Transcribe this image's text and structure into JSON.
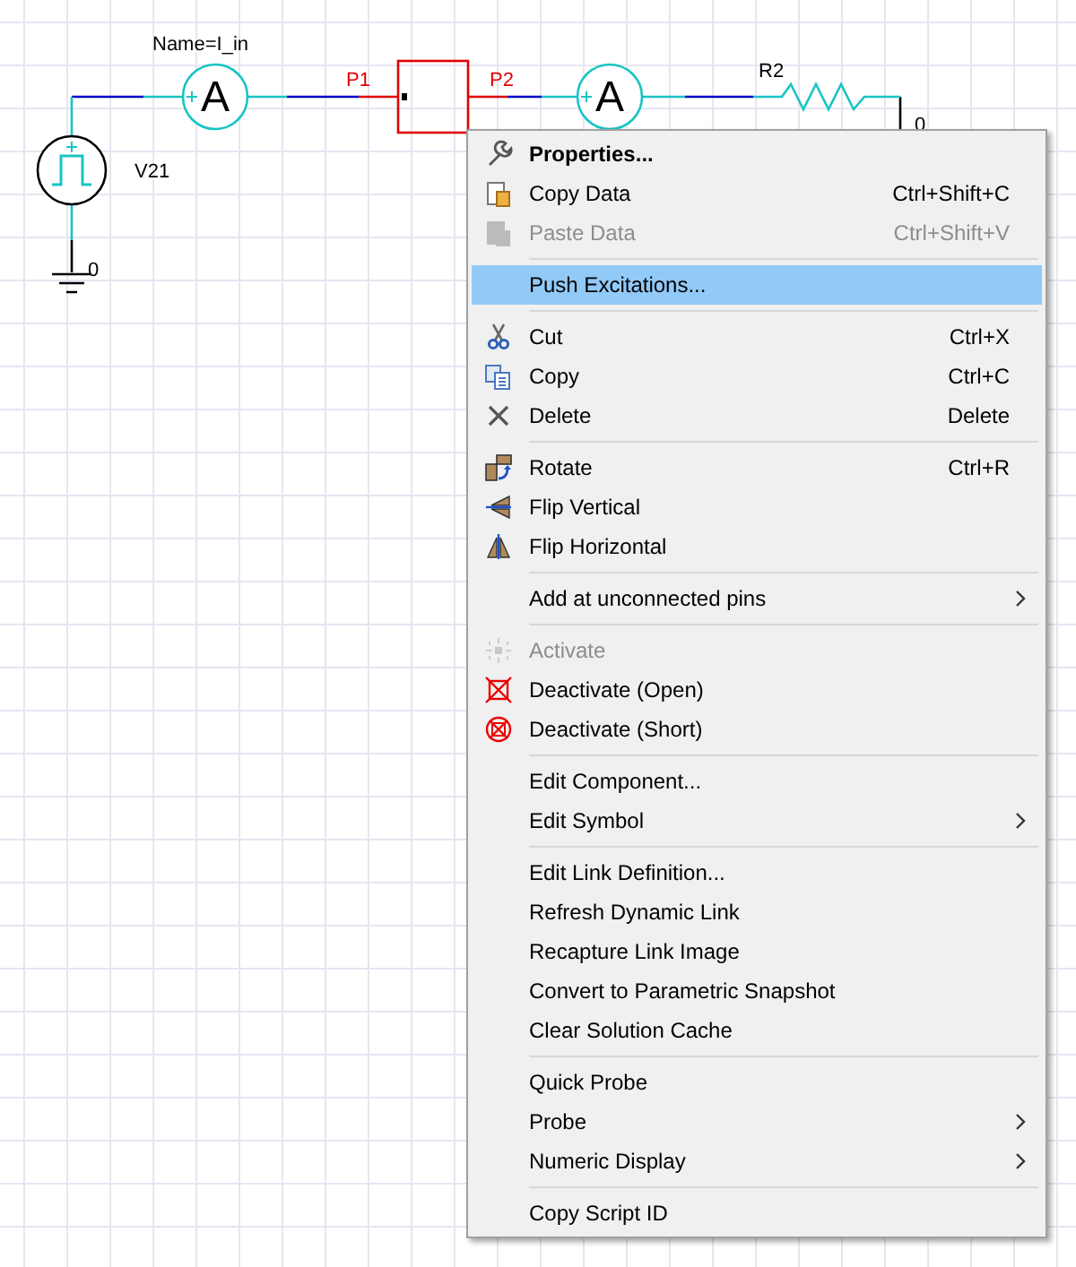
{
  "schematic": {
    "labels": [
      {
        "kind": "name",
        "text": "Name=I_in"
      },
      {
        "kind": "ammeter1",
        "text": "A"
      },
      {
        "kind": "port1",
        "text": "P1"
      },
      {
        "kind": "port2",
        "text": "P2"
      },
      {
        "kind": "ammeter2",
        "text": "A"
      },
      {
        "kind": "resistor",
        "text": "R2"
      },
      {
        "kind": "node_right",
        "text": "0"
      },
      {
        "kind": "source",
        "text": "V21"
      },
      {
        "kind": "node_ground",
        "text": "0"
      }
    ]
  },
  "context_menu": {
    "items": [
      {
        "kind": "item",
        "label": "Properties...",
        "default": true,
        "disabled": false,
        "selected": false,
        "submenu": false
      },
      {
        "kind": "item",
        "label": "Copy Data",
        "shortcut": "Ctrl+Shift+C",
        "default": false,
        "disabled": false,
        "selected": false,
        "submenu": false
      },
      {
        "kind": "item",
        "label": "Paste Data",
        "shortcut": "Ctrl+Shift+V",
        "default": false,
        "disabled": true,
        "selected": false,
        "submenu": false
      },
      {
        "kind": "separator"
      },
      {
        "kind": "item",
        "label": "Push Excitations...",
        "default": false,
        "disabled": false,
        "selected": true,
        "submenu": false
      },
      {
        "kind": "separator"
      },
      {
        "kind": "item",
        "label": "Cut",
        "shortcut": "Ctrl+X",
        "default": false,
        "disabled": false,
        "selected": false,
        "submenu": false
      },
      {
        "kind": "item",
        "label": "Copy",
        "shortcut": "Ctrl+C",
        "default": false,
        "disabled": false,
        "selected": false,
        "submenu": false
      },
      {
        "kind": "item",
        "label": "Delete",
        "shortcut": "Delete",
        "default": false,
        "disabled": false,
        "selected": false,
        "submenu": false
      },
      {
        "kind": "separator"
      },
      {
        "kind": "item",
        "label": "Rotate",
        "shortcut": "Ctrl+R",
        "default": false,
        "disabled": false,
        "selected": false,
        "submenu": false
      },
      {
        "kind": "item",
        "label": "Flip Vertical",
        "default": false,
        "disabled": false,
        "selected": false,
        "submenu": false
      },
      {
        "kind": "item",
        "label": "Flip Horizontal",
        "default": false,
        "disabled": false,
        "selected": false,
        "submenu": false
      },
      {
        "kind": "separator"
      },
      {
        "kind": "item",
        "label": "Add at unconnected pins",
        "default": false,
        "disabled": false,
        "selected": false,
        "submenu": true
      },
      {
        "kind": "separator"
      },
      {
        "kind": "item",
        "label": "Activate",
        "default": false,
        "disabled": true,
        "selected": false,
        "submenu": false
      },
      {
        "kind": "item",
        "label": "Deactivate (Open)",
        "default": false,
        "disabled": false,
        "selected": false,
        "submenu": false
      },
      {
        "kind": "item",
        "label": "Deactivate (Short)",
        "default": false,
        "disabled": false,
        "selected": false,
        "submenu": false
      },
      {
        "kind": "separator"
      },
      {
        "kind": "item",
        "label": "Edit Component...",
        "default": false,
        "disabled": false,
        "selected": false,
        "submenu": false
      },
      {
        "kind": "item",
        "label": "Edit Symbol",
        "default": false,
        "disabled": false,
        "selected": false,
        "submenu": true
      },
      {
        "kind": "separator"
      },
      {
        "kind": "item",
        "label": "Edit Link Definition...",
        "default": false,
        "disabled": false,
        "selected": false,
        "submenu": false
      },
      {
        "kind": "item",
        "label": "Refresh Dynamic Link",
        "default": false,
        "disabled": false,
        "selected": false,
        "submenu": false
      },
      {
        "kind": "item",
        "label": "Recapture Link Image",
        "default": false,
        "disabled": false,
        "selected": false,
        "submenu": false
      },
      {
        "kind": "item",
        "label": "Convert to Parametric Snapshot",
        "default": false,
        "disabled": false,
        "selected": false,
        "submenu": false
      },
      {
        "kind": "item",
        "label": "Clear Solution Cache",
        "default": false,
        "disabled": false,
        "selected": false,
        "submenu": false
      },
      {
        "kind": "separator"
      },
      {
        "kind": "item",
        "label": "Quick Probe",
        "default": false,
        "disabled": false,
        "selected": false,
        "submenu": false
      },
      {
        "kind": "item",
        "label": "Probe",
        "default": false,
        "disabled": false,
        "selected": false,
        "submenu": true
      },
      {
        "kind": "item",
        "label": "Numeric Display",
        "default": false,
        "disabled": false,
        "selected": false,
        "submenu": true
      },
      {
        "kind": "separator"
      },
      {
        "kind": "item",
        "label": "Copy Script ID",
        "default": false,
        "disabled": false,
        "selected": false,
        "submenu": false
      }
    ]
  }
}
